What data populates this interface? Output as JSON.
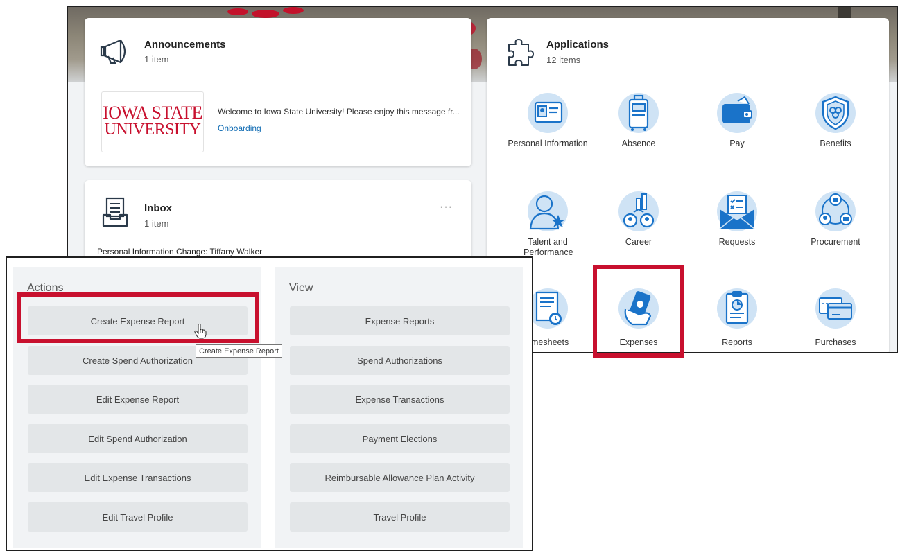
{
  "announcements": {
    "title": "Announcements",
    "count": "1 item",
    "logo_line1": "IOWA STATE",
    "logo_line2": "UNIVERSITY",
    "message": "Welcome to Iowa State University! Please enjoy this message fr...",
    "link": "Onboarding"
  },
  "inbox": {
    "title": "Inbox",
    "count": "1 item",
    "more": "···",
    "item": "Personal Information Change: Tiffany Walker"
  },
  "applications": {
    "title": "Applications",
    "count": "12 items",
    "items": [
      {
        "label": "Personal Information",
        "icon": "id-card-icon"
      },
      {
        "label": "Absence",
        "icon": "luggage-icon"
      },
      {
        "label": "Pay",
        "icon": "wallet-icon"
      },
      {
        "label": "Benefits",
        "icon": "shield-icon"
      },
      {
        "label": "Talent and Performance",
        "icon": "person-star-icon"
      },
      {
        "label": "Career",
        "icon": "career-chart-icon"
      },
      {
        "label": "Requests",
        "icon": "envelope-checklist-icon"
      },
      {
        "label": "Procurement",
        "icon": "procurement-cycle-icon"
      },
      {
        "label": "mesheets",
        "icon": "timesheet-icon"
      },
      {
        "label": "Expenses",
        "icon": "hand-money-icon"
      },
      {
        "label": "Reports",
        "icon": "clipboard-chart-icon"
      },
      {
        "label": "Purchases",
        "icon": "credit-card-icon"
      }
    ]
  },
  "actions": {
    "title": "Actions",
    "buttons": [
      "Create Expense Report",
      "Create Spend Authorization",
      "Edit Expense Report",
      "Edit Spend Authorization",
      "Edit Expense Transactions",
      "Edit Travel Profile"
    ]
  },
  "view": {
    "title": "View",
    "buttons": [
      "Expense Reports",
      "Spend Authorizations",
      "Expense Transactions",
      "Payment Elections",
      "Reimbursable Allowance Plan Activity",
      "Travel Profile"
    ]
  },
  "tooltip": "Create Expense Report",
  "colors": {
    "highlight": "#c8102e",
    "isu_red": "#c8102e",
    "link": "#0f6bb3",
    "icon_blue": "#1a73c9",
    "icon_bg": "#cfe3f5"
  }
}
